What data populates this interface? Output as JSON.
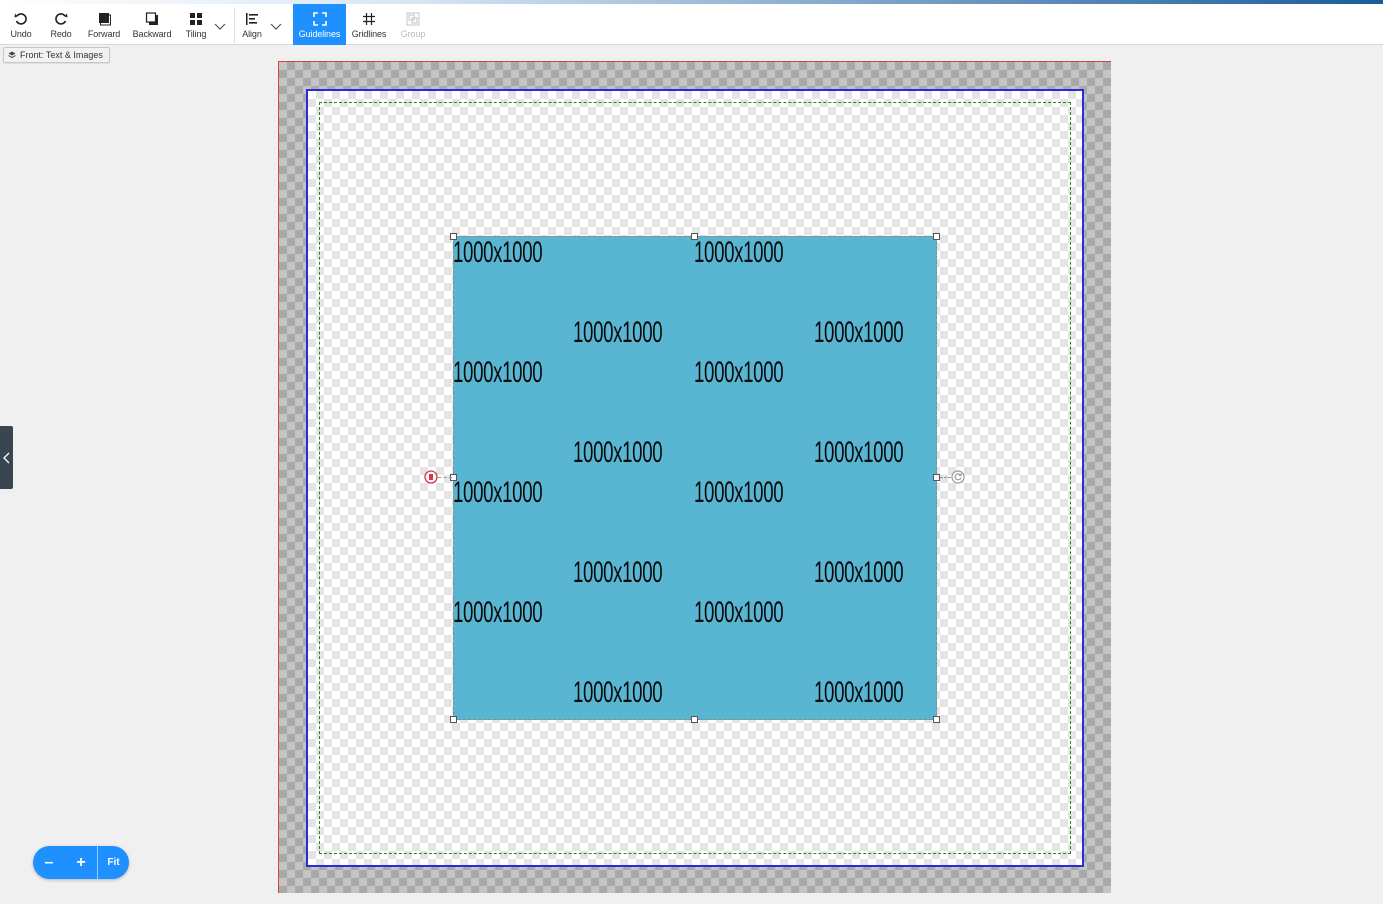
{
  "toolbar": {
    "undo": "Undo",
    "redo": "Redo",
    "forward": "Forward",
    "backward": "Backward",
    "tiling": "Tiling",
    "align": "Align",
    "guidelines": "Guidelines",
    "gridlines": "Gridlines",
    "group": "Group"
  },
  "layer": {
    "label": "Front: Text & Images"
  },
  "image_object": {
    "tile_text": "1000x1000",
    "fill_color": "#58b6d2"
  },
  "zoom": {
    "minus": "–",
    "plus": "+",
    "fit": "Fit"
  },
  "colors": {
    "accent": "#1e90ff",
    "bleed_line": "#d64545",
    "trim_line": "#2b2bdc",
    "safe_line": "#1c8a1c"
  }
}
